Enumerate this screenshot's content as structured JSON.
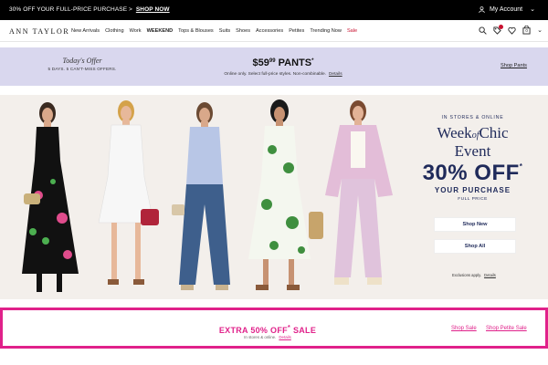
{
  "promo_bar": {
    "text": "30% OFF YOUR FULL-PRICE PURCHASE >",
    "link": "SHOP NOW",
    "account": "My Account"
  },
  "header": {
    "logo": "ANN TAYLOR",
    "nav": [
      "New Arrivals",
      "Clothing",
      "Work",
      "WEEKEND",
      "Tops & Blouses",
      "Suits",
      "Shoes",
      "Accessories",
      "Petites",
      "Trending Now",
      "Sale"
    ],
    "bag_count": "0"
  },
  "offer_band": {
    "todays_offer": "Today's Offer",
    "days": "5 DAYS. 5 CAN'T-MISS OFFERS.",
    "price_main": "$59",
    "price_cents": "99",
    "price_label": "PANTS",
    "price_mark": "*",
    "fine_print": "Online only. Select full-price styles. Non-combinable.",
    "details": "Details",
    "shop_link": "Shop Pants"
  },
  "hero": {
    "kicker": "IN STORES & ONLINE",
    "title_a": "Week",
    "title_of": "of",
    "title_b": "Chic",
    "title_c": "Event",
    "percent": "30% OFF",
    "percent_mark": "*",
    "your_purchase": "YOUR PURCHASE",
    "full_price": "FULL PRICE",
    "btn_shop_new": "Shop New",
    "btn_shop_all": "Shop All",
    "exclusions": "Exclusions apply.",
    "details": "Details"
  },
  "sale": {
    "title_a": "EXTRA 50% OFF",
    "title_mark": "*",
    "title_b": "SALE",
    "sub": "In stores & online.",
    "details": "Details",
    "link_1": "Shop Sale",
    "link_2": "Shop Petite Sale"
  },
  "colors": {
    "navy": "#1f2a5a",
    "lavender": "#d9d7ee",
    "pink": "#e0218a",
    "sale_red": "#c8102e"
  }
}
